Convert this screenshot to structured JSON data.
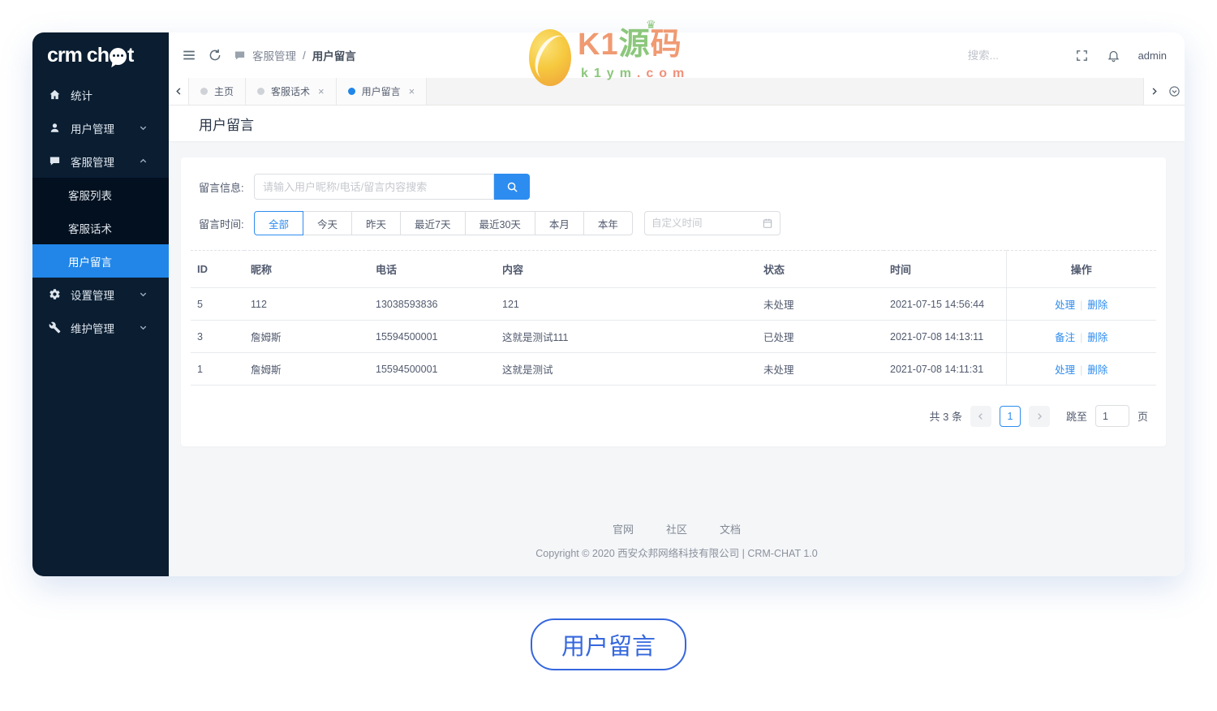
{
  "colors": {
    "accent": "#2d8cf0",
    "sidebar_bg": "#0a1d31",
    "submenu_bg": "#03101f",
    "active_item": "#2186e8",
    "pill_blue": "#3567de"
  },
  "logo": {
    "text_pre": "crm ch",
    "text_post": "t"
  },
  "sidebar": {
    "items": [
      {
        "label": "统计"
      },
      {
        "label": "用户管理"
      },
      {
        "label": "客服管理"
      },
      {
        "label": "设置管理"
      },
      {
        "label": "维护管理"
      }
    ],
    "submenu": [
      {
        "label": "客服列表"
      },
      {
        "label": "客服话术"
      },
      {
        "label": "用户留言"
      }
    ]
  },
  "topbar": {
    "breadcrumb": {
      "section": "客服管理",
      "separator": "/",
      "current": "用户留言"
    },
    "search_placeholder": "搜索...",
    "username": "admin"
  },
  "tabs": [
    {
      "label": "主页"
    },
    {
      "label": "客服话术",
      "close": "×"
    },
    {
      "label": "用户留言",
      "close": "×"
    }
  ],
  "page": {
    "title": "用户留言"
  },
  "filters": {
    "info_label": "留言信息:",
    "info_placeholder": "请输入用户昵称/电话/留言内容搜索",
    "time_label": "留言时间:",
    "time_options": [
      "全部",
      "今天",
      "昨天",
      "最近7天",
      "最近30天",
      "本月",
      "本年"
    ],
    "active_option": "全部",
    "custom_time_placeholder": "自定义时间"
  },
  "table": {
    "columns": [
      "ID",
      "昵称",
      "电话",
      "内容",
      "状态",
      "时间",
      "操作"
    ],
    "rows": [
      {
        "id": "5",
        "nickname": "112",
        "phone": "13038593836",
        "content": "121",
        "status": "未处理",
        "time": "2021-07-15 14:56:44",
        "actions": [
          "处理",
          "删除"
        ]
      },
      {
        "id": "3",
        "nickname": "詹姆斯",
        "phone": "15594500001",
        "content": "这就是测试111",
        "status": "已处理",
        "time": "2021-07-08 14:13:11",
        "actions": [
          "备注",
          "删除"
        ]
      },
      {
        "id": "1",
        "nickname": "詹姆斯",
        "phone": "15594500001",
        "content": "这就是测试",
        "status": "未处理",
        "time": "2021-07-08 14:11:31",
        "actions": [
          "处理",
          "删除"
        ]
      }
    ]
  },
  "pagination": {
    "total_text": "共 3 条",
    "current_page": "1",
    "jump_label": "跳至",
    "jump_value": "1",
    "page_suffix": "页"
  },
  "footer": {
    "links": [
      "官网",
      "社区",
      "文档"
    ],
    "copyright": "Copyright © 2020 西安众邦网络科技有限公司 | CRM-CHAT 1.0"
  },
  "watermark": {
    "brand_k1": "K1",
    "brand_yuan": "源",
    "brand_ma": "码",
    "crown": "♛",
    "domain_green": "k1ym",
    "domain_orange": ".com"
  },
  "bottom_badge": {
    "label": "用户留言"
  }
}
